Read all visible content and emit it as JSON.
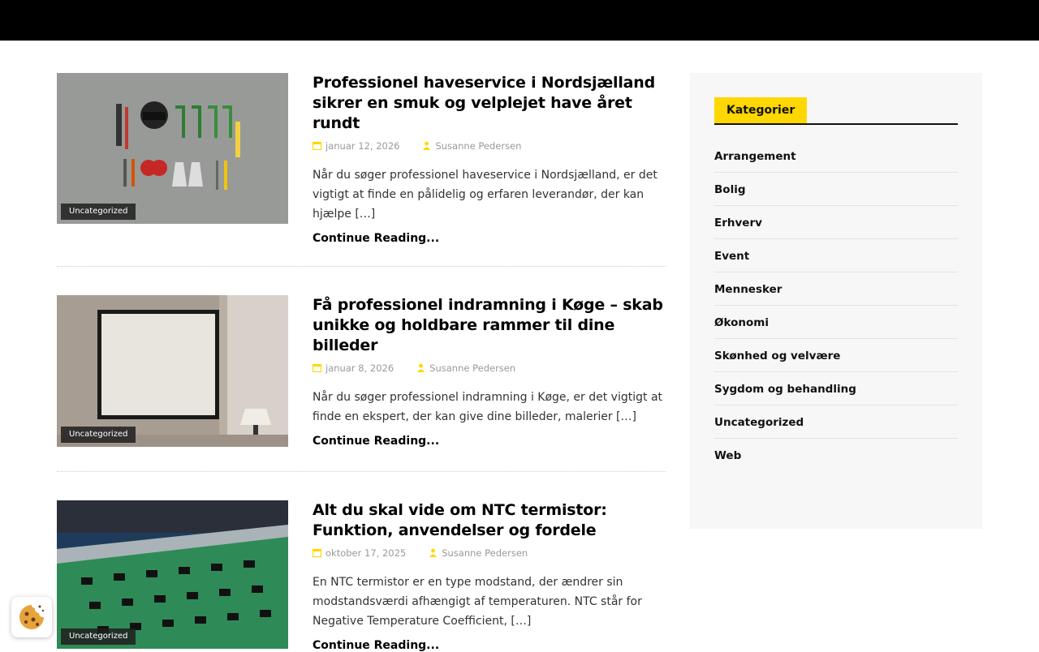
{
  "posts": [
    {
      "title": "Professionel haveservice i Nordsjælland sikrer en smuk og velplejet have året rundt",
      "date": "januar 12, 2026",
      "author": "Susanne Pedersen",
      "excerpt": "Når du søger professionel haveservice i Nordsjælland, er det vigtigt at finde en pålidelig og erfaren leverandør, der kan hjælpe […]",
      "category": "Uncategorized",
      "more": "Continue Reading..."
    },
    {
      "title": "Få professionel indramning i Køge – skab unikke og holdbare rammer til dine billeder",
      "date": "januar 8, 2026",
      "author": "Susanne Pedersen",
      "excerpt": "Når du søger professionel indramning i Køge, er det vigtigt at finde en ekspert, der kan give dine billeder, malerier […]",
      "category": "Uncategorized",
      "more": "Continue Reading..."
    },
    {
      "title": "Alt du skal vide om NTC termistor: Funktion, anvendelser og fordele",
      "date": "oktober 17, 2025",
      "author": "Susanne Pedersen",
      "excerpt": "En NTC termistor er en type modstand, der ændrer sin modstandsværdi afhængigt af temperaturen. NTC står for Negative Temperature Coefficient, […]",
      "category": "Uncategorized",
      "more": "Continue Reading..."
    }
  ],
  "sidebar": {
    "title": "Kategorier",
    "items": [
      "Arrangement",
      "Bolig",
      "Erhverv",
      "Event",
      "Mennesker",
      "Økonomi",
      "Skønhed og velvære",
      "Sygdom og behandling",
      "Uncategorized",
      "Web"
    ]
  },
  "colors": {
    "accent": "#ffd700",
    "topbar": "#000000"
  },
  "icons": {
    "date": "calendar-icon",
    "author": "user-icon",
    "cookie": "cookie-icon"
  }
}
